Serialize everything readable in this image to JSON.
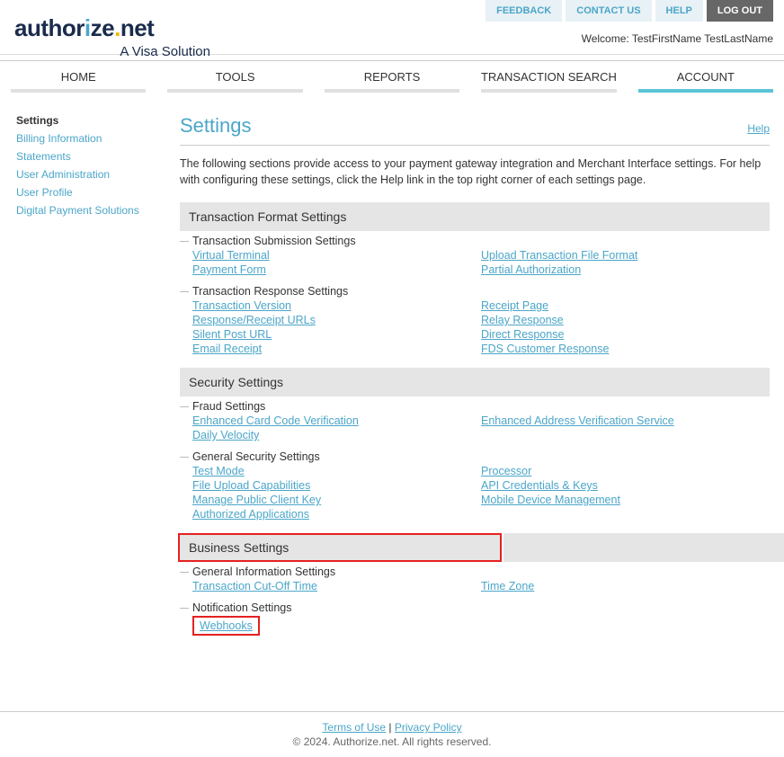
{
  "topButtons": {
    "feedback": "FEEDBACK",
    "contact": "CONTACT US",
    "help": "HELP",
    "logout": "LOG OUT"
  },
  "welcome": "Welcome: TestFirstName TestLastName",
  "logo": {
    "text": "authorize.net",
    "tagline": "A Visa Solution"
  },
  "nav": {
    "home": "HOME",
    "tools": "TOOLS",
    "reports": "REPORTS",
    "search": "TRANSACTION SEARCH",
    "account": "ACCOUNT"
  },
  "sidebar": {
    "settings": "Settings",
    "billing": "Billing Information",
    "statements": "Statements",
    "useradmin": "User Administration",
    "userprofile": "User Profile",
    "digital": "Digital Payment Solutions"
  },
  "pageTitle": "Settings",
  "helpLink": "Help",
  "intro": "The following sections provide access to your payment gateway integration and Merchant Interface settings. For help with configuring these settings, click the Help link in the top right corner of each settings page.",
  "sections": {
    "tfs": {
      "title": "Transaction Format Settings",
      "sub1": {
        "title": "Transaction Submission Settings",
        "left": {
          "l1": "Virtual Terminal",
          "l2": "Payment Form"
        },
        "right": {
          "r1": "Upload Transaction File Format",
          "r2": "Partial Authorization"
        }
      },
      "sub2": {
        "title": "Transaction Response Settings",
        "left": {
          "l1": "Transaction Version",
          "l2": "Response/Receipt URLs",
          "l3": "Silent Post URL",
          "l4": "Email Receipt"
        },
        "right": {
          "r1": "Receipt Page",
          "r2": "Relay Response",
          "r3": "Direct Response",
          "r4": "FDS Customer Response"
        }
      }
    },
    "ss": {
      "title": "Security Settings",
      "sub1": {
        "title": "Fraud Settings",
        "left": {
          "l1": "Enhanced Card Code Verification",
          "l2": "Daily Velocity"
        },
        "right": {
          "r1": "Enhanced Address Verification Service"
        }
      },
      "sub2": {
        "title": "General Security Settings",
        "left": {
          "l1": "Test Mode",
          "l2": "File Upload Capabilities",
          "l3": "Manage Public Client Key",
          "l4": "Authorized Applications"
        },
        "right": {
          "r1": "Processor",
          "r2": "API Credentials & Keys",
          "r3": "Mobile Device Management"
        }
      }
    },
    "bs": {
      "title": "Business Settings",
      "sub1": {
        "title": "General Information Settings",
        "left": {
          "l1": "Transaction Cut-Off Time"
        },
        "right": {
          "r1": "Time Zone"
        }
      },
      "sub2": {
        "title": "Notification Settings",
        "left": {
          "l1": "Webhooks"
        }
      }
    }
  },
  "footer": {
    "terms": "Terms of Use",
    "sep": " |  ",
    "privacy": "Privacy Policy",
    "copy": "© 2024. Authorize.net. All rights reserved."
  }
}
